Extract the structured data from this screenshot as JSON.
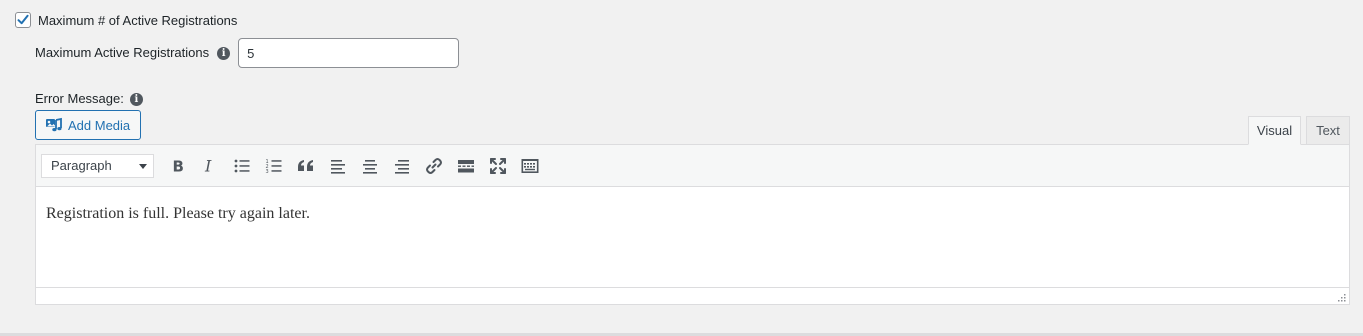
{
  "limit": {
    "checkbox_label": "Maximum # of Active Registrations",
    "checked": true,
    "field_label": "Maximum Active Registrations",
    "value": "5"
  },
  "error_message": {
    "label": "Error Message:",
    "add_media_label": "Add Media",
    "tabs": {
      "visual": "Visual",
      "text": "Text"
    },
    "format_select": "Paragraph",
    "content": "Registration is full. Please try again later.",
    "toolbar_icons": [
      "bold-icon",
      "italic-icon",
      "bullet-list-icon",
      "numbered-list-icon",
      "blockquote-icon",
      "align-left-icon",
      "align-center-icon",
      "align-right-icon",
      "link-icon",
      "read-more-icon",
      "fullscreen-icon",
      "toolbar-toggle-icon"
    ]
  },
  "colors": {
    "accent": "#2271b1",
    "icon": "#50575e",
    "border": "#dcdcde",
    "background": "#f1f1f1"
  }
}
